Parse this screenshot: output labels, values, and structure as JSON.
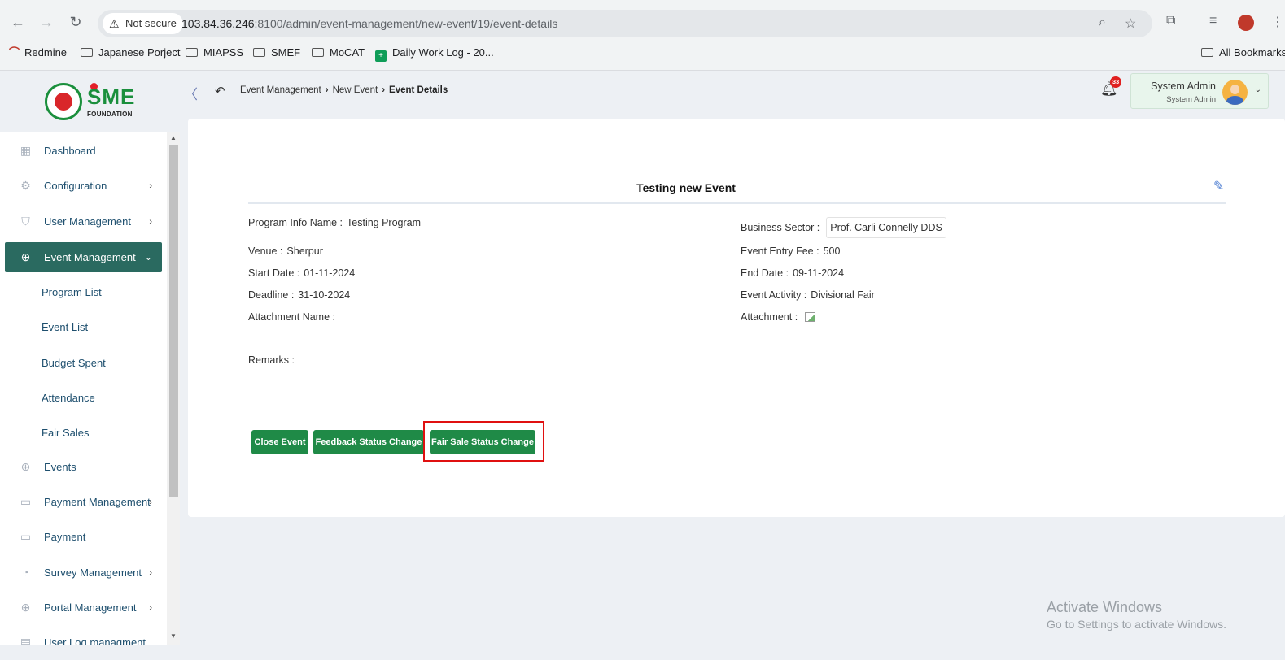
{
  "browser": {
    "security_label": "Not secure",
    "url_host": "103.84.36.246",
    "url_rest": ":8100/admin/event-management/new-event/19/event-details",
    "bookmarks": [
      {
        "label": "Redmine",
        "icon": "redmine-icon"
      },
      {
        "label": "Japanese Porject",
        "icon": "folder-icon"
      },
      {
        "label": "MIAPSS",
        "icon": "folder-icon"
      },
      {
        "label": "SMEF",
        "icon": "folder-icon"
      },
      {
        "label": "MoCAT",
        "icon": "folder-icon"
      },
      {
        "label": "Daily Work Log - 20...",
        "icon": "sheets-icon"
      }
    ],
    "all_bookmarks_label": "All Bookmarks"
  },
  "logo": {
    "mark": "SME",
    "subtitle": "FOUNDATION"
  },
  "breadcrumb": [
    {
      "label": "Event Management"
    },
    {
      "label": "New Event"
    },
    {
      "label": "Event Details"
    }
  ],
  "notifications": {
    "count": "33"
  },
  "user": {
    "name": "System Admin",
    "role": "System Admin"
  },
  "sidebar": {
    "items": [
      {
        "label": "Dashboard",
        "icon": "dashboard-icon",
        "chevron": ""
      },
      {
        "label": "Configuration",
        "icon": "configuration-icon",
        "chevron": "›"
      },
      {
        "label": "User Management",
        "icon": "shield-icon",
        "chevron": "›"
      },
      {
        "label": "Event Management",
        "icon": "lock-icon",
        "chevron": "⌄"
      },
      {
        "label": "Events",
        "icon": "lock-icon",
        "chevron": ""
      },
      {
        "label": "Payment Management",
        "icon": "money-icon",
        "chevron": "›"
      },
      {
        "label": "Payment",
        "icon": "money-icon",
        "chevron": ""
      },
      {
        "label": "Survey Management",
        "icon": "pie-icon",
        "chevron": "›"
      },
      {
        "label": "Portal Management",
        "icon": "lock-icon",
        "chevron": "›"
      },
      {
        "label": "User Log managment",
        "icon": "log-icon",
        "chevron": ""
      }
    ],
    "subitems": [
      {
        "label": "Program List"
      },
      {
        "label": "Event List"
      },
      {
        "label": "Budget Spent"
      },
      {
        "label": "Attendance"
      },
      {
        "label": "Fair Sales"
      }
    ]
  },
  "event": {
    "title": "Testing new Event",
    "program_info_label": "Program Info Name :",
    "program_info_value": "Testing Program",
    "business_sector_label": "Business Sector :",
    "business_sector_value": "Prof. Carli Connelly DDS",
    "venue_label": "Venue :",
    "venue_value": "Sherpur",
    "entry_fee_label": "Event Entry Fee :",
    "entry_fee_value": "500",
    "start_date_label": "Start Date :",
    "start_date_value": "01-11-2024",
    "end_date_label": "End Date :",
    "end_date_value": "09-11-2024",
    "deadline_label": "Deadline :",
    "deadline_value": "31-10-2024",
    "activity_label": "Event Activity :",
    "activity_value": "Divisional Fair",
    "attachment_name_label": "Attachment Name :",
    "attachment_label": "Attachment :",
    "remarks_label": "Remarks :"
  },
  "actions": {
    "close_event": "Close Event",
    "feedback_status": "Feedback Status Change",
    "fair_sale_status": "Fair Sale Status Change"
  },
  "watermark": {
    "line1": "Activate Windows",
    "line2": "Go to Settings to activate Windows."
  }
}
